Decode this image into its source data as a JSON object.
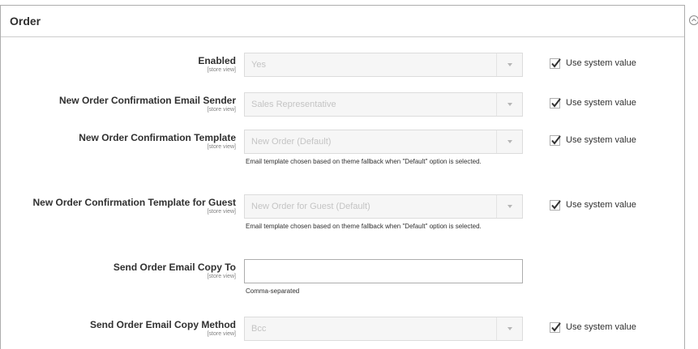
{
  "section": {
    "title": "Order"
  },
  "use_system_label": "Use system value",
  "fields": [
    {
      "label": "Enabled",
      "scope": "[store view]",
      "value": "Yes",
      "use_system": true
    },
    {
      "label": "New Order Confirmation Email Sender",
      "scope": "[store view]",
      "value": "Sales Representative",
      "use_system": true
    },
    {
      "label": "New Order Confirmation Template",
      "scope": "[store view]",
      "value": "New Order (Default)",
      "note": "Email template chosen based on theme fallback when \"Default\" option is selected.",
      "use_system": true
    },
    {
      "label": "New Order Confirmation Template for Guest",
      "scope": "[store view]",
      "value": "New Order for Guest (Default)",
      "note": "Email template chosen based on theme fallback when \"Default\" option is selected.",
      "use_system": true
    },
    {
      "label": "Send Order Email Copy To",
      "scope": "[store view]",
      "value": "",
      "note": "Comma-separated"
    },
    {
      "label": "Send Order Email Copy Method",
      "scope": "[store view]",
      "value": "Bcc",
      "use_system": true
    }
  ]
}
